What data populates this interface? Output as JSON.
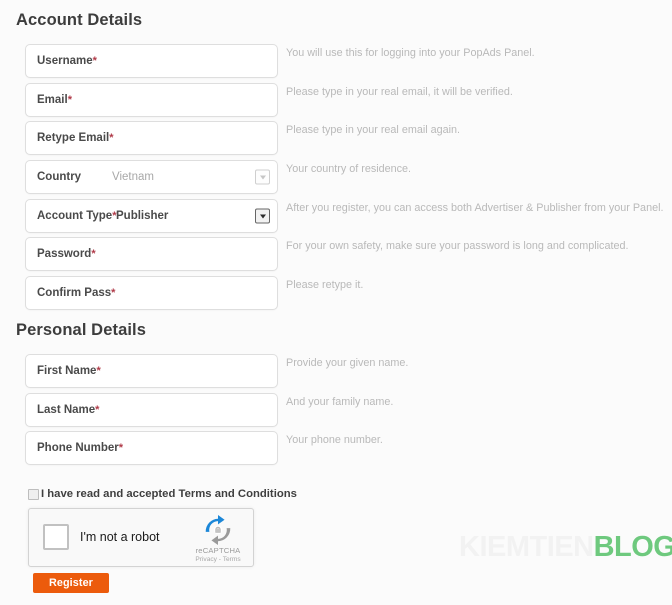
{
  "sections": {
    "account": {
      "heading": "Account Details"
    },
    "personal": {
      "heading": "Personal Details"
    }
  },
  "account_fields": [
    {
      "label": "Username",
      "required": "*",
      "value": "",
      "help": "You will use this for logging into your PopAds Panel."
    },
    {
      "label": "Email",
      "required": "*",
      "value": "",
      "help": "Please type in your real email, it will be verified."
    },
    {
      "label": "Retype Email",
      "required": "*",
      "value": "",
      "help": "Please type in your real email again."
    },
    {
      "label": "Country",
      "required": "",
      "value": "Vietnam",
      "help": "Your country of residence."
    },
    {
      "label": "Account Type",
      "required": "*",
      "value": "Publisher",
      "help": "After you register, you can access both Advertiser & Publisher from your Panel."
    },
    {
      "label": "Password",
      "required": "*",
      "value": "",
      "help": "For your own safety, make sure your password is long and complicated."
    },
    {
      "label": "Confirm Pass",
      "required": "*",
      "value": "",
      "help": "Please retype it."
    }
  ],
  "personal_fields": [
    {
      "label": "First Name",
      "required": "*",
      "value": "",
      "help": "Provide your given name."
    },
    {
      "label": "Last Name",
      "required": "*",
      "value": "",
      "help": "And your family name."
    },
    {
      "label": "Phone Number",
      "required": "*",
      "value": "",
      "help": "Your phone number."
    }
  ],
  "terms": {
    "label": "I have read and accepted Terms and Conditions",
    "checked": false
  },
  "recaptcha": {
    "label": "I'm not a robot",
    "brand": "reCAPTCHA",
    "links": "Privacy - Terms",
    "checked": false
  },
  "register_button": {
    "label": "Register"
  },
  "watermark": {
    "part1": "KIEMTIEN",
    "part2": "BLOG"
  },
  "colors": {
    "accent_orange": "#ec5b0c",
    "required_red": "#b03a48",
    "watermark_green": "#6ec97e",
    "help_gray": "#b9b9b9",
    "background": "#fbfbfb"
  }
}
